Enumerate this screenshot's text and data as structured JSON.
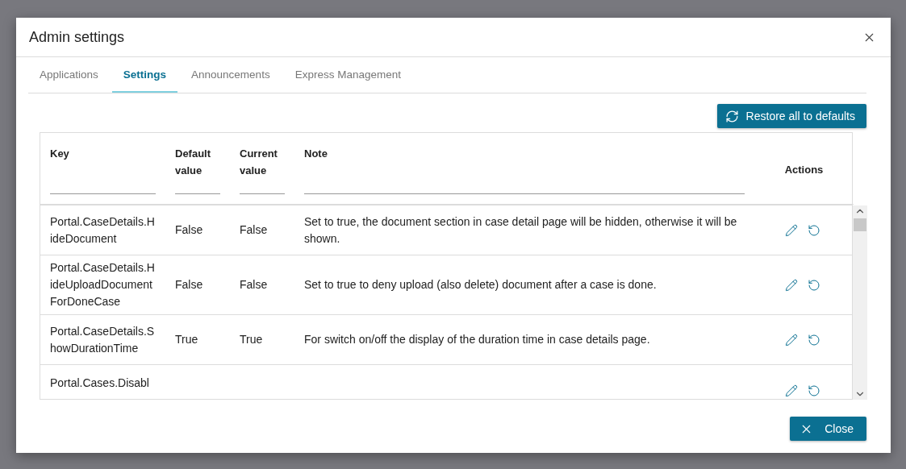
{
  "dialog": {
    "title": "Admin settings"
  },
  "tabs": [
    {
      "label": "Applications",
      "selected": false
    },
    {
      "label": "Settings",
      "selected": true
    },
    {
      "label": "Announcements",
      "selected": false
    },
    {
      "label": "Express Management",
      "selected": false
    }
  ],
  "restore_button": "Restore all to defaults",
  "table": {
    "columns": [
      "Key",
      "Default value",
      "Current value",
      "Note",
      "Actions"
    ],
    "rows": [
      {
        "key": "Portal.CaseDetails.HideDocument",
        "default": "False",
        "current": "False",
        "note": "Set to true, the document section in case detail page will be hidden, otherwise it will be shown."
      },
      {
        "key": "Portal.CaseDetails.HideUploadDocumentForDoneCase",
        "default": "False",
        "current": "False",
        "note": "Set to true to deny upload (also delete) document after a case is done."
      },
      {
        "key": "Portal.CaseDetails.ShowDurationTime",
        "default": "True",
        "current": "True",
        "note": "For switch on/off the display of the duration time in case details page."
      },
      {
        "key": "Portal.Cases.Disabl"
      }
    ]
  },
  "close_button": "Close"
}
